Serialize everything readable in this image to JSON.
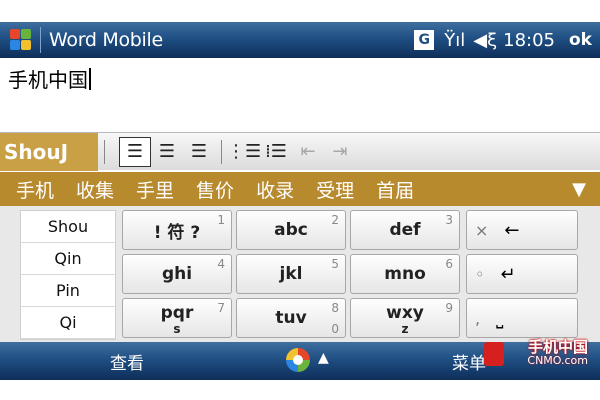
{
  "titlebar": {
    "app_title": "Word Mobile",
    "status_g": "G",
    "signal_icon": "signal-icon",
    "volume_icon": "volume-icon",
    "clock": "18:05",
    "ok_label": "ok"
  },
  "document": {
    "text": "手机中国"
  },
  "toolbar": {
    "ime_label": "ShouJ",
    "buttons": [
      {
        "icon": "align-left-icon",
        "glyph": "≡"
      },
      {
        "icon": "align-center-icon",
        "glyph": "≡"
      },
      {
        "icon": "align-right-icon",
        "glyph": "≡"
      },
      {
        "icon": "numbered-list-icon",
        "glyph": "⁝≡"
      },
      {
        "icon": "bullet-list-icon",
        "glyph": "⁝≡"
      },
      {
        "icon": "decrease-indent-icon",
        "glyph": "⇤"
      },
      {
        "icon": "increase-indent-icon",
        "glyph": "⇥"
      }
    ]
  },
  "candidates": [
    "手机",
    "收集",
    "手里",
    "售价",
    "收录",
    "受理",
    "首届"
  ],
  "pinyin_options": [
    "Shou",
    "Qin",
    "Pin",
    "Qi"
  ],
  "keys": [
    {
      "label": "! 符 ?",
      "num": "1"
    },
    {
      "label": "abc",
      "num": "2"
    },
    {
      "label": "def",
      "num": "3"
    },
    {
      "label": "ghi",
      "num": "4"
    },
    {
      "label": "jkl",
      "num": "5"
    },
    {
      "label": "mno",
      "num": "6"
    },
    {
      "label": "pqr",
      "sub": "s",
      "num": "7"
    },
    {
      "label": "tuv",
      "num": "8",
      "subnum": "0"
    },
    {
      "label": "wxy",
      "sub": "z",
      "num": "9"
    }
  ],
  "function_keys": [
    {
      "mark": "×",
      "icon": "backspace-icon",
      "glyph": "←"
    },
    {
      "mark": "◦",
      "icon": "enter-icon",
      "glyph": "↵"
    },
    {
      "mark": ",",
      "icon": "space-icon",
      "glyph": "⎵"
    }
  ],
  "bottombar": {
    "left_soft": "查看",
    "right_soft": "菜单"
  },
  "watermark": {
    "main": "手机中国",
    "sub": "CNMO.com"
  }
}
